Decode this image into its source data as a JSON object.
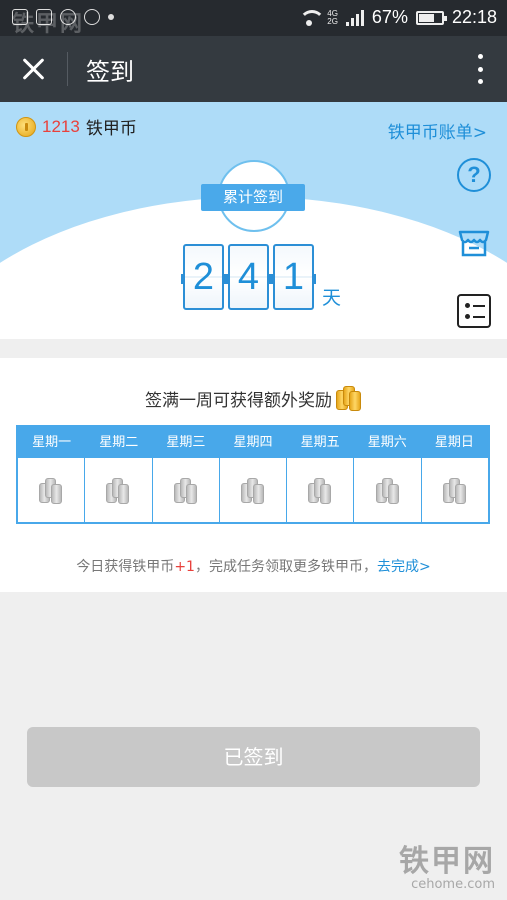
{
  "status_bar": {
    "battery": "67%",
    "battery_level": 0.67,
    "time": "22:18",
    "network": "4G"
  },
  "watermark": {
    "brand": "铁甲网",
    "domain": "cehome.com"
  },
  "title_bar": {
    "title": "签到"
  },
  "hero": {
    "coin_balance": "1213",
    "coin_unit": "铁甲币",
    "bill_link": "铁甲币账单>",
    "badge_label": "累计签到",
    "streak_digits": [
      "2",
      "4",
      "1"
    ],
    "streak_unit": "天",
    "colors": {
      "accent": "#1f8fd8",
      "banner": "#aedcf8",
      "highlight": "#e8413c"
    }
  },
  "week": {
    "title": "签满一周可获得额外奖励",
    "days": [
      "星期一",
      "星期二",
      "星期三",
      "星期四",
      "星期五",
      "星期六",
      "星期日"
    ],
    "note_prefix": "今日获得铁甲币",
    "note_plus": "+1",
    "note_middle": "，完成任务领取更多铁甲币，",
    "note_link": "去完成>"
  },
  "footer": {
    "signed_button": "已签到"
  }
}
